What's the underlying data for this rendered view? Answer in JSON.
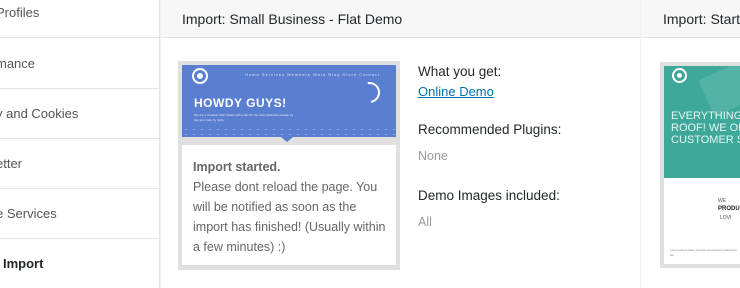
{
  "sidebar": {
    "items": [
      {
        "label": "Profiles"
      },
      {
        "label": "mance"
      },
      {
        "label": "y and Cookies"
      },
      {
        "label": "etter"
      },
      {
        "label": "e Services"
      },
      {
        "label": "Import"
      }
    ]
  },
  "card1": {
    "title": "Import: Small Business - Flat Demo",
    "preview": {
      "nav": "Home Services Members Work Blog Store Contact",
      "headline": "HOWDY GUYS!",
      "sub": "We are a Creative Web Studio with a flair for the bold, distinctive design by day and code by night."
    },
    "message": {
      "started": "Import started.",
      "body": "Please dont reload the page. You will be notified as soon as the import has finished! (Usually within a few minutes) :)"
    },
    "info": {
      "what_label": "What you get:",
      "what_link": "Online Demo",
      "plugins_label": "Recommended Plugins:",
      "plugins_value": "None",
      "images_label": "Demo Images included:",
      "images_value": "All"
    }
  },
  "card2": {
    "title": "Import: Start",
    "preview": {
      "headline": "EVERYTHING U\nROOF! WE OF\nCUSTOMER SU",
      "line1": "WE",
      "line2": "PRODU",
      "line3": "LOVI",
      "footer": "Lorem ipsum dolor sit amet consectetur adipiscing elit"
    }
  }
}
